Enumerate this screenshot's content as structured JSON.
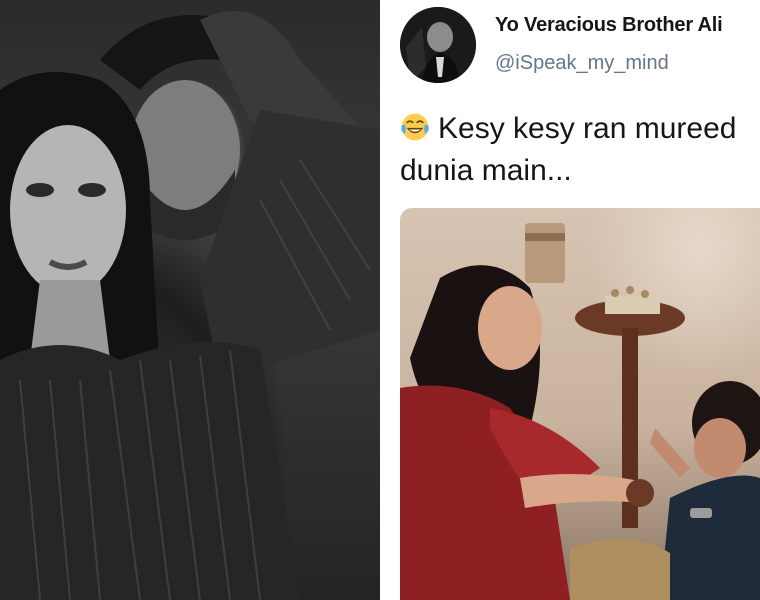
{
  "tweet": {
    "display_name": "Yo Veracious Brother Ali",
    "handle": "@iSpeak_my_mind",
    "emoji": "face-with-tears-of-joy",
    "text_line1": "Kesy kesy ran mureed",
    "text_line2": "dunia main..."
  },
  "colors": {
    "name_text": "#14171a",
    "handle_text": "#657786",
    "background": "#ffffff"
  }
}
